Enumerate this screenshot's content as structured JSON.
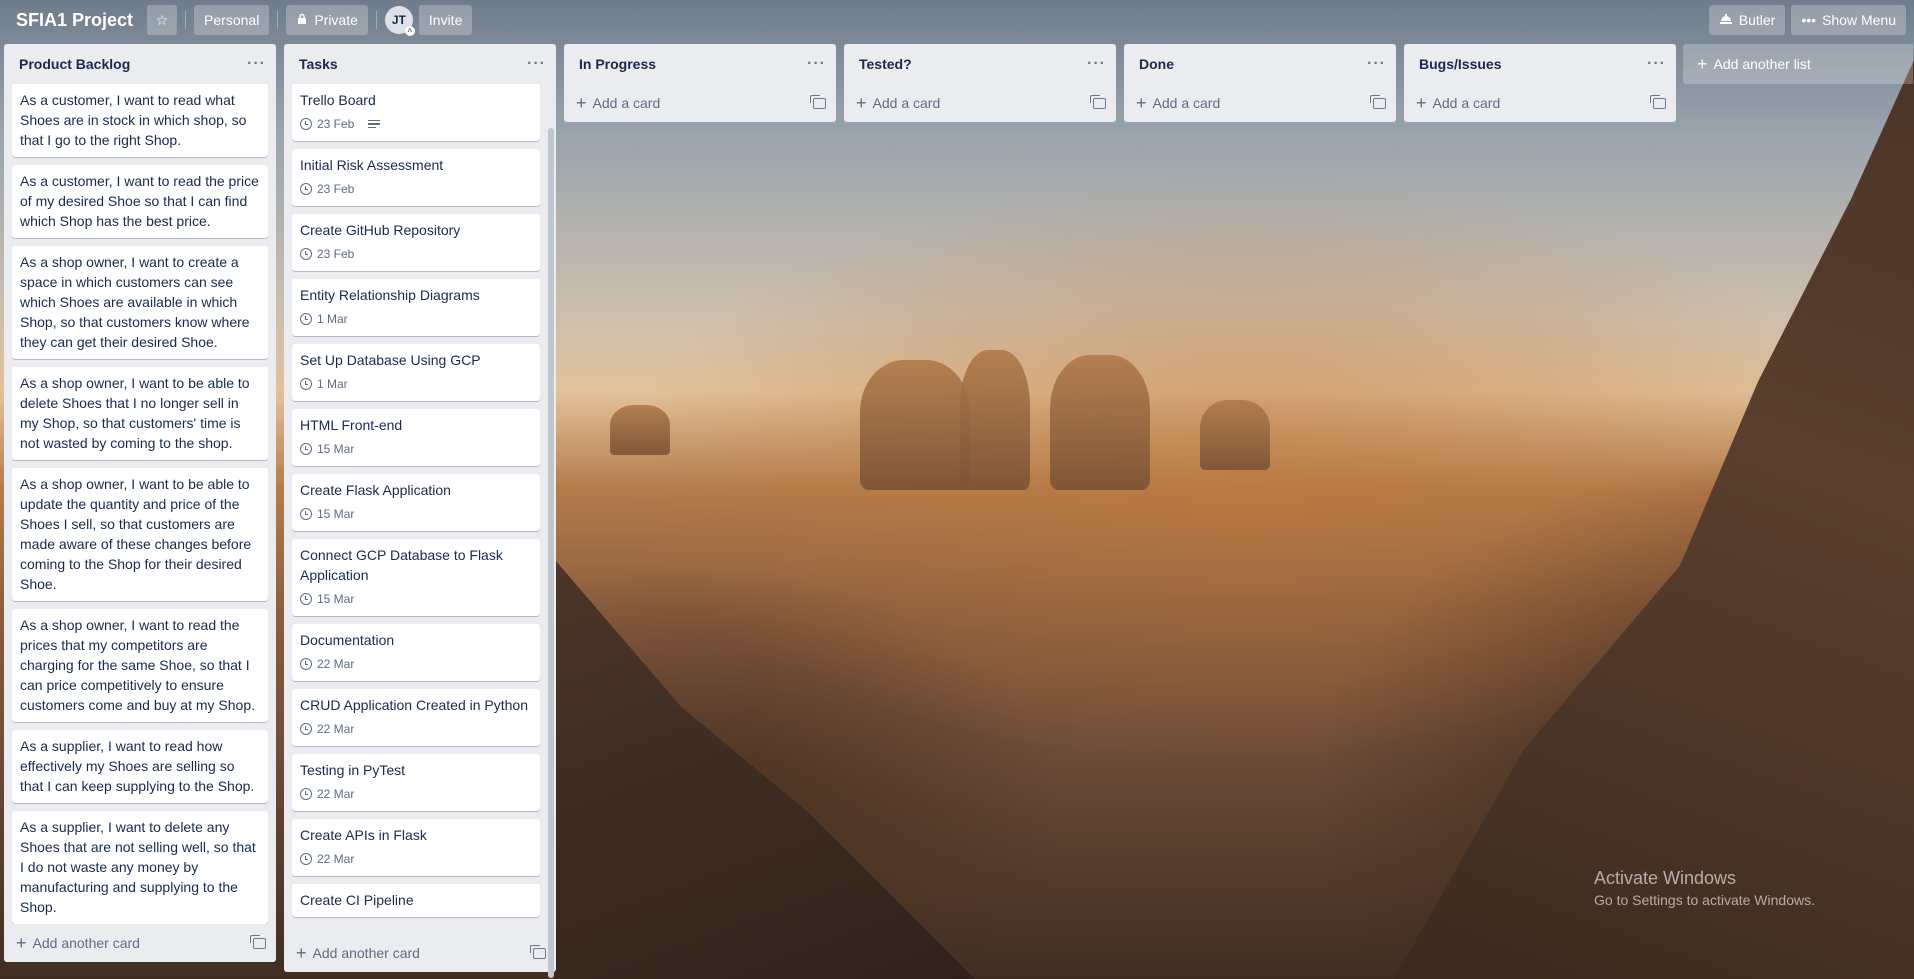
{
  "header": {
    "title": "SFIA1 Project",
    "visibility_team": "Personal",
    "visibility": "Private",
    "avatar_initials": "JT",
    "invite": "Invite",
    "butler": "Butler",
    "show_menu": "Show Menu"
  },
  "lists": [
    {
      "title": "Product Backlog",
      "cards": [
        {
          "text": "As a customer, I want to read what Shoes are in stock in which shop, so that I go to the right Shop."
        },
        {
          "text": "As a customer, I want to read the price of my desired Shoe so that I can find which Shop has the best price."
        },
        {
          "text": "As a shop owner, I want to create a space in which customers can see which Shoes are available in which Shop, so that customers know where they can get their desired Shoe."
        },
        {
          "text": "As a shop owner, I want to be able to delete Shoes that I no longer sell in my Shop, so that customers' time is not wasted by coming to the shop."
        },
        {
          "text": "As a shop owner, I want to be able to update the quantity and price of the Shoes I sell, so that customers are made aware of these changes before coming to the Shop for their desired Shoe."
        },
        {
          "text": "As a shop owner, I want to read the prices that my competitors are charging for the same Shoe, so that I can price competitively to ensure customers come and buy at my Shop."
        },
        {
          "text": "As a supplier, I want to read how effectively my Shoes are selling so that I can keep supplying to the Shop."
        },
        {
          "text": "As a supplier, I want to delete any Shoes that are not selling well, so that I do not waste any money by manufacturing and supplying to the Shop."
        }
      ],
      "footer": "Add another card"
    },
    {
      "title": "Tasks",
      "cards": [
        {
          "text": "Trello Board",
          "due": "23 Feb",
          "has_description": true
        },
        {
          "text": "Initial Risk Assessment",
          "due": "23 Feb"
        },
        {
          "text": "Create GitHub Repository",
          "due": "23 Feb"
        },
        {
          "text": "Entity Relationship Diagrams",
          "due": "1 Mar"
        },
        {
          "text": "Set Up Database Using GCP",
          "due": "1 Mar"
        },
        {
          "text": "HTML Front-end",
          "due": "15 Mar"
        },
        {
          "text": "Create Flask Application",
          "due": "15 Mar"
        },
        {
          "text": "Connect GCP Database to Flask Application",
          "due": "15 Mar"
        },
        {
          "text": "Documentation",
          "due": "22 Mar"
        },
        {
          "text": "CRUD Application Created in Python",
          "due": "22 Mar"
        },
        {
          "text": "Testing in PyTest",
          "due": "22 Mar"
        },
        {
          "text": "Create APIs in Flask",
          "due": "22 Mar"
        },
        {
          "text": "Create CI Pipeline"
        }
      ],
      "footer": "Add another card"
    },
    {
      "title": "In Progress",
      "cards": [],
      "footer": "Add a card"
    },
    {
      "title": "Tested?",
      "cards": [],
      "footer": "Add a card"
    },
    {
      "title": "Done",
      "cards": [],
      "footer": "Add a card"
    },
    {
      "title": "Bugs/Issues",
      "cards": [],
      "footer": "Add a card"
    }
  ],
  "add_list": "Add another list",
  "watermark": {
    "line1": "Activate Windows",
    "line2": "Go to Settings to activate Windows."
  },
  "colors": {
    "list_bg": "#ebecf0",
    "text": "#172b4d",
    "muted": "#5e6c84"
  }
}
